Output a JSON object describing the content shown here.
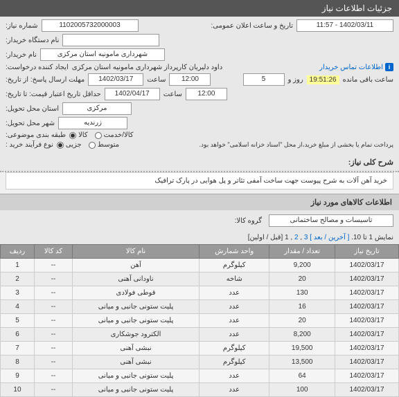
{
  "header": {
    "title": "جزئیات اطلاعات نیاز"
  },
  "form": {
    "nf_label": "شماره نیاز:",
    "nf_value": "1102005732000003",
    "dt_label": "تاریخ و ساعت اعلان عمومی:",
    "dt_value": "1402/03/11 - 11:57",
    "buyer_unit_label": "نام دستگاه خریدار:",
    "buyer_name_label": "نام خریدار:",
    "buyer_name_value": "شهرداری مامونیه استان مرکزی",
    "creator_label": "ایجاد کننده درخواست:",
    "creator_value": "داود  دلیریان  کارپرداز  شهرداری مامونیه استان مرکزی",
    "contact_link": "اطلاعات تماس خریدار",
    "deadline_label": "مهلت ارسال پاسخ: از تاریخ:",
    "deadline_date": "1402/03/17",
    "time_lbl": "ساعت",
    "deadline_time": "12:00",
    "day_lbl": "روز و",
    "days_remaining": "5",
    "timer": "19:51:26",
    "remain_lbl": "ساعت باقی مانده",
    "validity_label": "حداقل تاریخ اعتبار قیمت: تا تاریخ:",
    "validity_date": "1402/04/17",
    "validity_time": "12:00",
    "province_label": "استان محل تحویل:",
    "province_value": "مرکزی",
    "city_label": "شهر محل تحویل:",
    "city_value": "زرندیه",
    "cat_label": "طبقه بندی موضوعی:",
    "cat_kala": "کالا",
    "cat_khadamat": "کالا/خدمت",
    "proc_label": "نوع فرآیند خرید :",
    "proc_small": "جزیی",
    "proc_medium": "متوسط",
    "proc_note": "پرداخت تمام یا بخشی از مبلغ خرید،از محل \"اسناد خزانه اسلامی\" خواهد بود."
  },
  "desc": {
    "title": "شرح کلی نیاز:",
    "text": "خرید آهن آلات به شرح پیوست جهت ساخت آمفی تئاتر و پل هوایی در پارک ترافیک"
  },
  "items": {
    "header": "اطلاعات کالاهای مورد نیاز",
    "group_label": "گروه کالا:",
    "group_value": "تاسیسات و مصالح ساختمانی",
    "pager_text": "نمایش 1 تا 10.",
    "pager_last": "[ آخرین",
    "pager_next": "/ بعد ]",
    "pager_p3": "3",
    "pager_p2": "2",
    "pager_p1": "1",
    "pager_first": "[قبل / اولین]"
  },
  "table": {
    "cols": {
      "row": "ردیف",
      "code": "کد کالا",
      "name": "نام کالا",
      "unit": "واحد شمارش",
      "qty": "تعداد / مقدار",
      "date": "تاریخ نیاز"
    },
    "rows": [
      {
        "n": "1",
        "code": "--",
        "name": "آهن",
        "unit": "کیلوگرم",
        "qty": "9,200",
        "date": "1402/03/17"
      },
      {
        "n": "2",
        "code": "--",
        "name": "ناودانی آهنی",
        "unit": "شاخه",
        "qty": "20",
        "date": "1402/03/17"
      },
      {
        "n": "3",
        "code": "--",
        "name": "قوطی فولادی",
        "unit": "عدد",
        "qty": "130",
        "date": "1402/03/17"
      },
      {
        "n": "4",
        "code": "--",
        "name": "پلیت ستونی جانبی و میانی",
        "unit": "عدد",
        "qty": "16",
        "date": "1402/03/17"
      },
      {
        "n": "5",
        "code": "--",
        "name": "پلیت ستونی جانبی و میانی",
        "unit": "عدد",
        "qty": "20",
        "date": "1402/03/17"
      },
      {
        "n": "6",
        "code": "--",
        "name": "الکترود جوشکاری",
        "unit": "عدد",
        "qty": "8,200",
        "date": "1402/03/17"
      },
      {
        "n": "7",
        "code": "--",
        "name": "نبشی آهنی",
        "unit": "کیلوگرم",
        "qty": "19,500",
        "date": "1402/03/17"
      },
      {
        "n": "8",
        "code": "--",
        "name": "نبشی آهنی",
        "unit": "کیلوگرم",
        "qty": "13,500",
        "date": "1402/03/17"
      },
      {
        "n": "9",
        "code": "--",
        "name": "پلیت ستونی جانبی و میانی",
        "unit": "عدد",
        "qty": "64",
        "date": "1402/03/17"
      },
      {
        "n": "10",
        "code": "--",
        "name": "پلیت ستونی جانبی و میانی",
        "unit": "عدد",
        "qty": "100",
        "date": "1402/03/17"
      }
    ]
  }
}
